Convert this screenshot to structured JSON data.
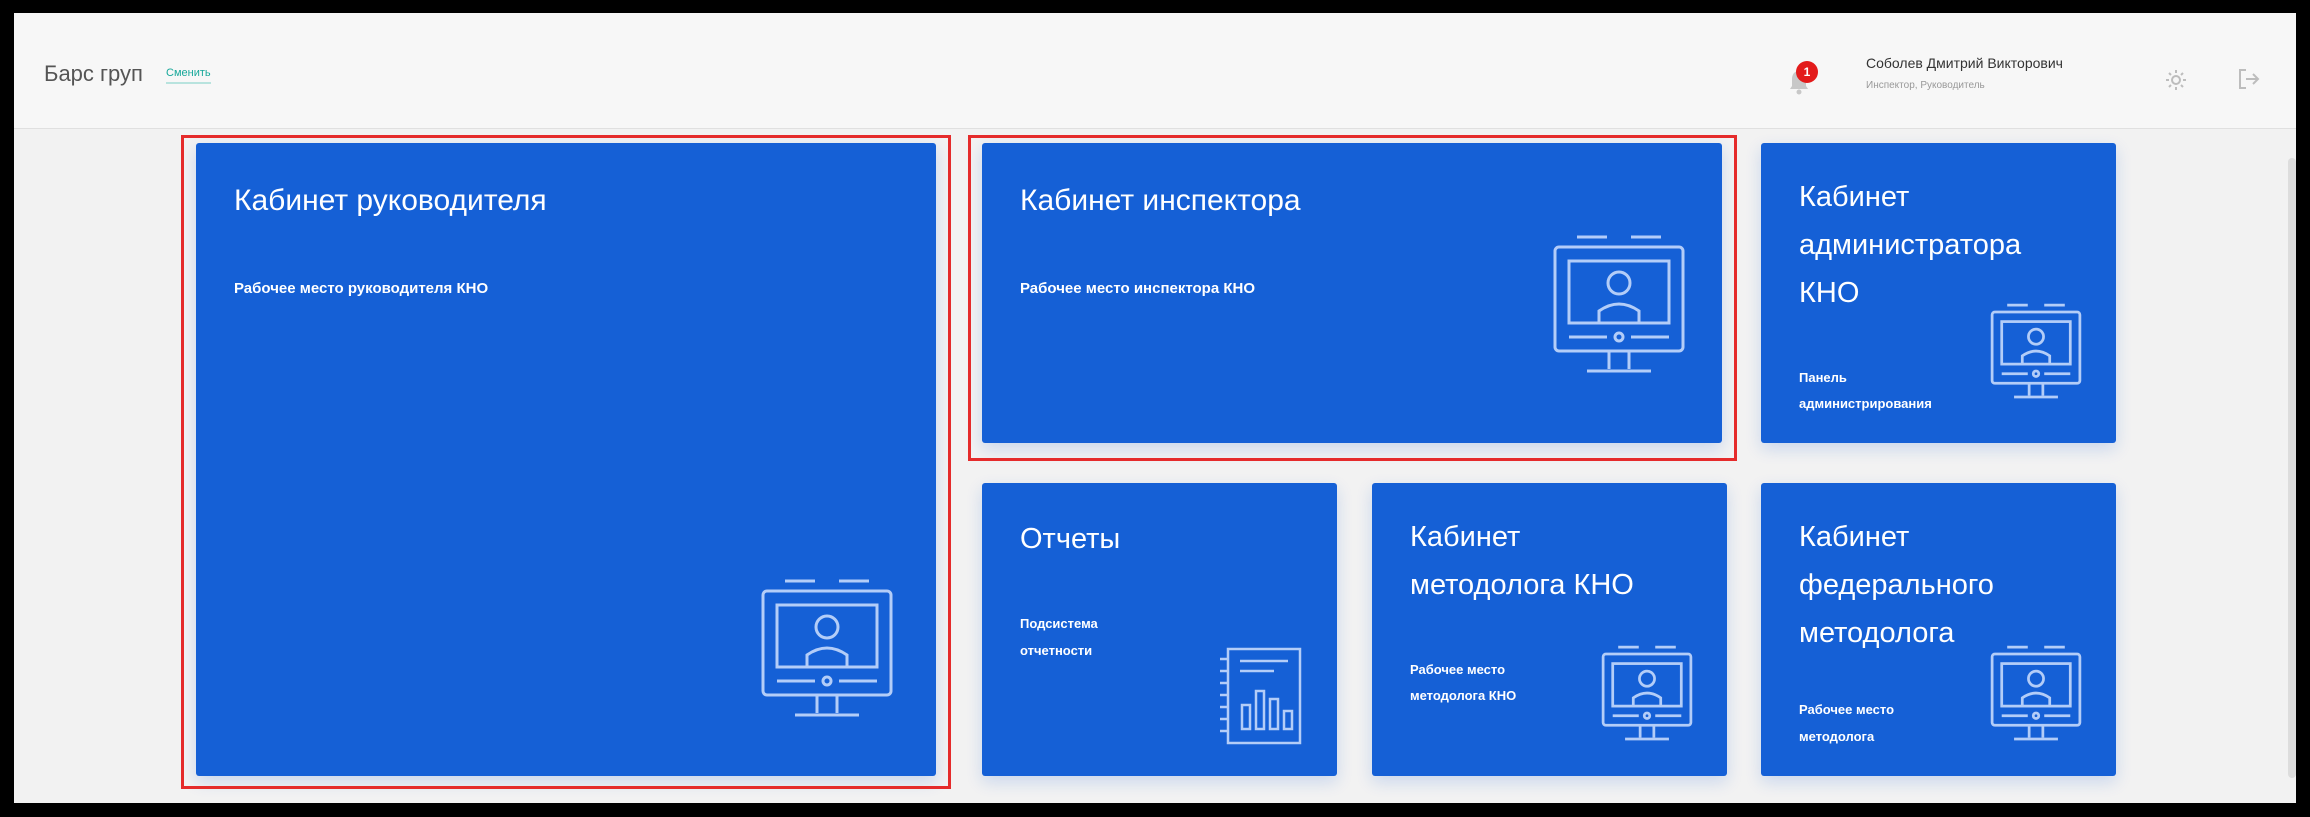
{
  "header": {
    "org_name": "Барс груп",
    "change_link": "Сменить",
    "notification_count": "1",
    "user_name": "Соболев Дмитрий Викторович",
    "user_role": "Инспектор, Руководитель"
  },
  "cards": {
    "director": {
      "title": "Кабинет руководителя",
      "subtitle": "Рабочее место руководителя КНО",
      "icon": "monitor-person-icon"
    },
    "inspector": {
      "title": "Кабинет инспектора",
      "subtitle": "Рабочее место инспектора КНО",
      "icon": "monitor-person-icon"
    },
    "admin": {
      "title_line1": "Кабинет",
      "title_line2": "администратора",
      "title_line3": "КНО",
      "subtitle_line1": "Панель",
      "subtitle_line2": "администрирования",
      "icon": "monitor-person-icon"
    },
    "reports": {
      "title": "Отчеты",
      "subtitle_line1": "Подсистема",
      "subtitle_line2": "отчетности",
      "icon": "report-chart-icon"
    },
    "methodologist": {
      "title_line1": "Кабинет",
      "title_line2": "методолога КНО",
      "subtitle_line1": "Рабочее место",
      "subtitle_line2": "методолога КНО",
      "icon": "monitor-person-icon"
    },
    "federal": {
      "title_line1": "Кабинет",
      "title_line2": "федерального",
      "title_line3": "методолога",
      "subtitle_line1": "Рабочее место",
      "subtitle_line2": "методолога",
      "icon": "monitor-person-icon"
    }
  },
  "colors": {
    "card": "#1560d6",
    "highlight": "#e52b2b",
    "accent": "#17a89a",
    "badge": "#e31b1b"
  }
}
